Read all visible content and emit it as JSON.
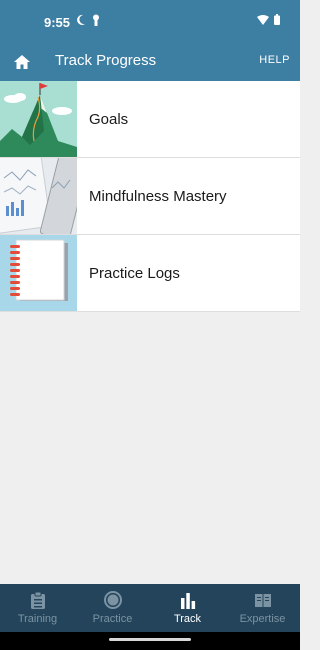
{
  "status_bar": {
    "time": "9:55",
    "icons": [
      "moon-icon",
      "keyhole-icon",
      "wifi-icon",
      "battery-icon"
    ]
  },
  "app_bar": {
    "title": "Track Progress",
    "help_label": "HELP",
    "home_icon": "home-icon"
  },
  "list": [
    {
      "label": "Goals",
      "thumb": "mountain-flag"
    },
    {
      "label": "Mindfulness Mastery",
      "thumb": "charts-tablet"
    },
    {
      "label": "Practice Logs",
      "thumb": "spiral-notebook"
    }
  ],
  "bottom_nav": [
    {
      "label": "Training",
      "icon": "clipboard-icon",
      "active": false
    },
    {
      "label": "Practice",
      "icon": "circle-icon",
      "active": false
    },
    {
      "label": "Track",
      "icon": "bar-chart-icon",
      "active": true
    },
    {
      "label": "Expertise",
      "icon": "book-icon",
      "active": false
    }
  ],
  "colors": {
    "header": "#3d7ea3",
    "bottom_nav": "#23445a",
    "active_tab": "#ffffff",
    "inactive_tab": "#7b93a3"
  }
}
